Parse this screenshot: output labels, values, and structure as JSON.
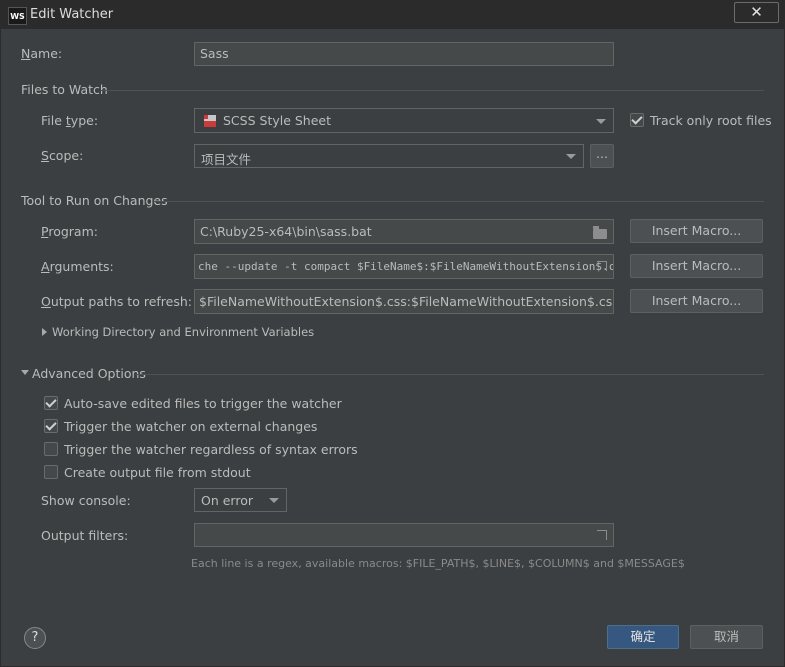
{
  "window": {
    "title": "Edit Watcher",
    "app_icon": "WS",
    "close_glyph": "✕"
  },
  "name": {
    "label": "Name:",
    "value": "Sass"
  },
  "files_to_watch": {
    "section_label": "Files to Watch",
    "file_type_label": "File type:",
    "file_type_value": "SCSS Style Sheet",
    "file_type_icon": "scss-file-icon",
    "track_root_label": "Track only root files",
    "track_root_checked": true,
    "scope_label": "Scope:",
    "scope_value": "项目文件",
    "scope_browse": "..."
  },
  "tool": {
    "section_label": "Tool to Run on Changes",
    "program_label": "Program:",
    "program_value": "C:\\Ruby25-x64\\bin\\sass.bat",
    "arguments_label": "Arguments:",
    "arguments_value": "che --update -t compact $FileName$:$FileNameWithoutExtension$.css",
    "output_label": "Output paths to refresh:",
    "output_value": "$FileNameWithoutExtension$.css:$FileNameWithoutExtension$.css.map",
    "insert_macro_label": "Insert Macro...",
    "working_dir_label": "Working Directory and Environment Variables"
  },
  "advanced": {
    "section_label": "Advanced Options",
    "options": [
      {
        "label": "Auto-save edited files to trigger the watcher",
        "checked": true
      },
      {
        "label": "Trigger the watcher on external changes",
        "checked": true
      },
      {
        "label": "Trigger the watcher regardless of syntax errors",
        "checked": false
      },
      {
        "label": "Create output file from stdout",
        "checked": false
      }
    ],
    "show_console_label": "Show console:",
    "show_console_value": "On error",
    "output_filters_label": "Output filters:",
    "output_filters_value": "",
    "hint": "Each line is a regex, available macros: $FILE_PATH$, $LINE$, $COLUMN$ and $MESSAGE$"
  },
  "footer": {
    "help_label": "?",
    "ok_label": "确定",
    "cancel_label": "取消"
  },
  "colors": {
    "background": "#3c3f41",
    "field": "#45494a",
    "primary_button": "#365880"
  }
}
